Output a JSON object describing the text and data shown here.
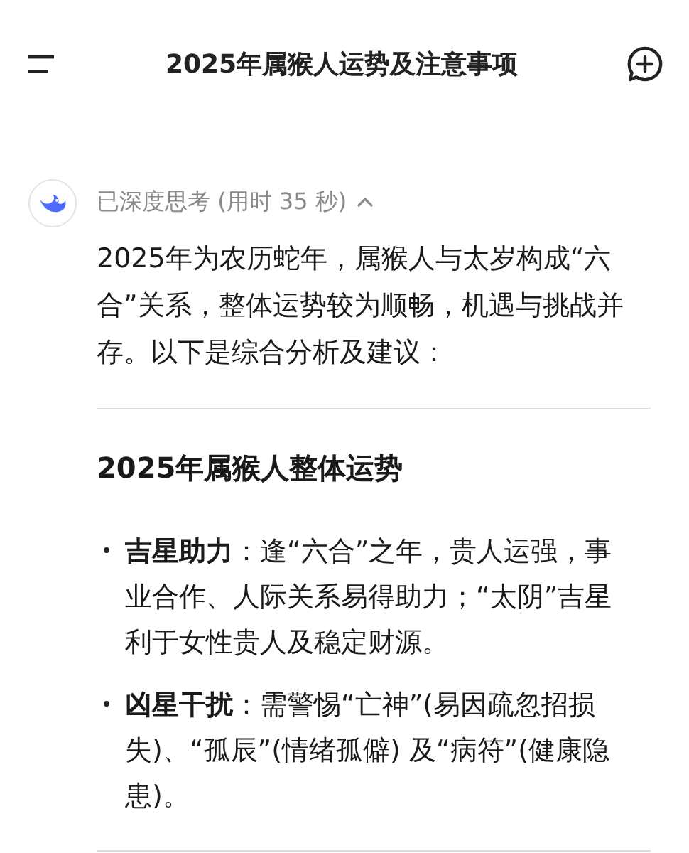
{
  "header": {
    "title": "2025年属猴人运势及注意事项"
  },
  "thinking": {
    "label": "已深度思考 (用时 35 秒)",
    "expanded": true
  },
  "intro": "2025年为农历蛇年，属猴人与太岁构成“六合”关系，整体运势较为顺畅，机遇与挑战并存。以下是综合分析及建议：",
  "section": {
    "heading": "2025年属猴人整体运势",
    "bullets": [
      "**吉星助力**：逢“六合”之年，贵人运强，事业合作、人际关系易得助力；“太阴”吉星利于女性贵人及稳定财源。",
      "**凶星干扰**：需警惕“亡神”(易因疏忽招损失)、“孤辰”(情绪孤僻) 及“病符”(健康隐患)。"
    ]
  }
}
